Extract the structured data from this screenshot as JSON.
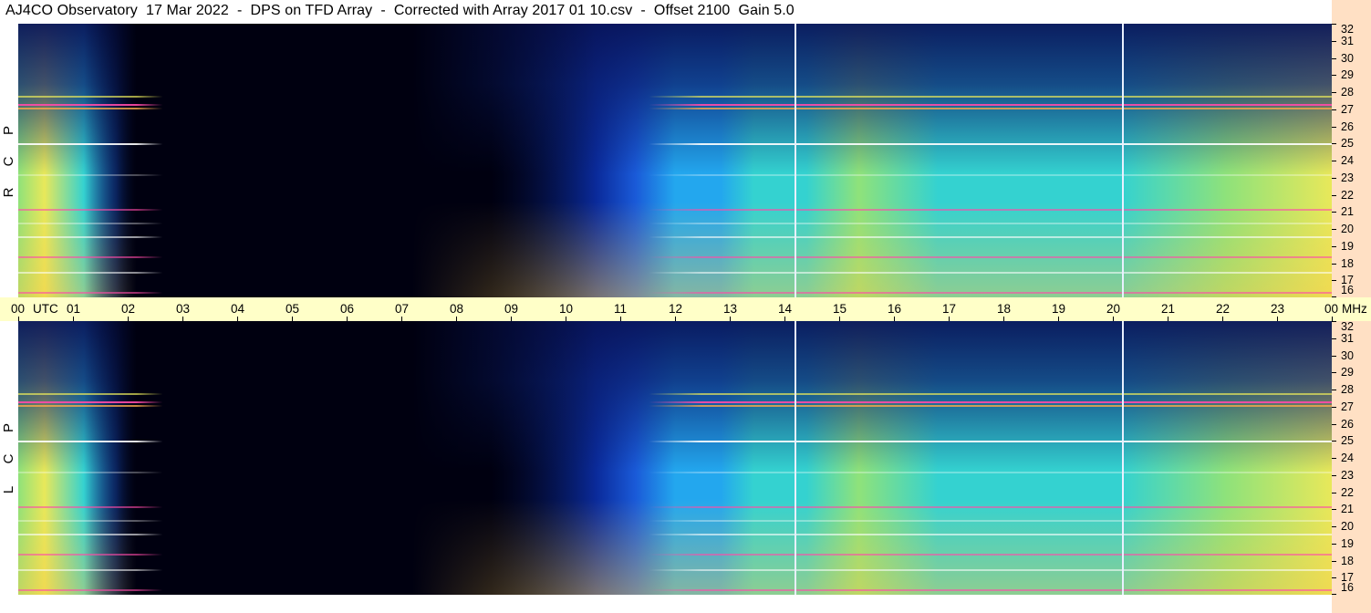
{
  "window": {
    "title": "AJ4CO Observatory  17 Mar 2022  -  DPS on TFD Array  -  Corrected with Array 2017 01 10.csv  -  Offset 2100  Gain 5.0"
  },
  "chart_data": {
    "type": "heatmap",
    "title": "AJ4CO Observatory  17 Mar 2022  -  DPS on TFD Array  -  Corrected with Array 2017 01 10.csv  -  Offset 2100  Gain 5.0",
    "x_axis": {
      "unit_label": "UTC",
      "tick_labels": [
        "00",
        "01",
        "02",
        "03",
        "04",
        "05",
        "06",
        "07",
        "08",
        "09",
        "10",
        "11",
        "12",
        "13",
        "14",
        "15",
        "16",
        "17",
        "18",
        "19",
        "20",
        "21",
        "22",
        "23",
        "00"
      ],
      "range_hours": [
        0,
        24
      ]
    },
    "y_axis": {
      "unit_label": "MHz",
      "tick_labels": [
        "32",
        "31",
        "30",
        "29",
        "28",
        "27",
        "26",
        "25",
        "24",
        "23",
        "22",
        "21",
        "20",
        "19",
        "18",
        "17",
        "16"
      ],
      "range_mhz": [
        16,
        32
      ]
    },
    "panels": [
      {
        "name": "RCP",
        "letters": [
          "R",
          "C",
          "P"
        ]
      },
      {
        "name": "LCP",
        "letters": [
          "L",
          "C",
          "P"
        ]
      }
    ],
    "vertical_markers_utc_hours": [
      14.18,
      20.17
    ],
    "colormap": [
      "#000010",
      "#06124a",
      "#0a2a9a",
      "#1a5ad8",
      "#23a7ee",
      "#34d2d0",
      "#8fe27a",
      "#e8e85a",
      "#f7a84a",
      "#ff4aa8",
      "#ffffff"
    ],
    "colors": {
      "background": "#ffffff",
      "time_axis_band": "#ffffc8",
      "frequency_scale_band": "#ffe0c4"
    }
  }
}
